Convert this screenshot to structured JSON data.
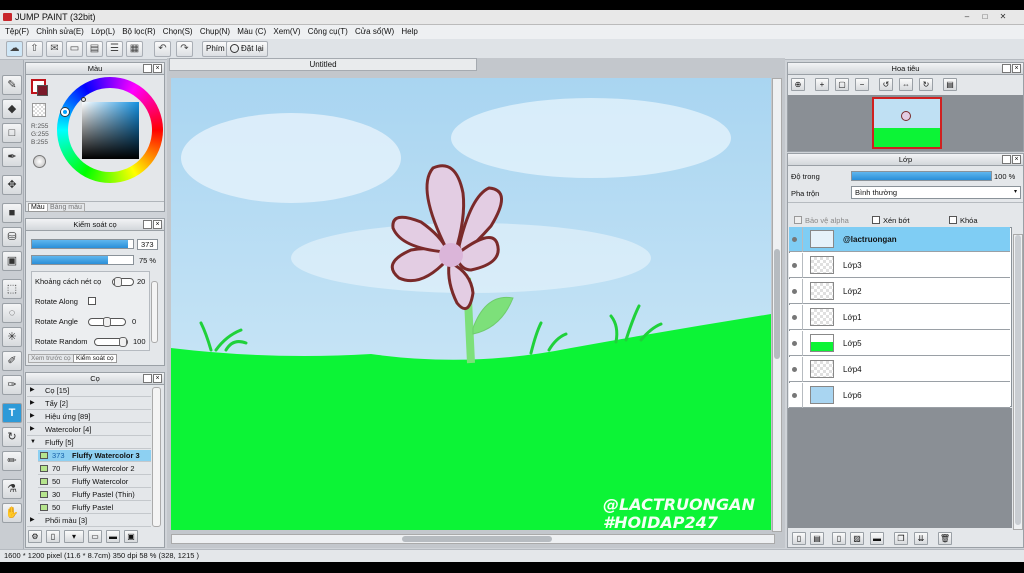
{
  "window": {
    "title": "JUMP PAINT (32bit)",
    "controls": [
      "–",
      "□",
      "✕"
    ]
  },
  "menu": [
    "Tệp(F)",
    "Chỉnh sửa(E)",
    "Lớp(L)",
    "Bộ lọc(R)",
    "Chọn(S)",
    "Chụp(N)",
    "Màu (C)",
    "Xem(V)",
    "Công cụ(T)",
    "Cửa sổ(W)",
    "Help"
  ],
  "toolbar": {
    "phim_label": "Phím",
    "reset_label": "Đặt lại"
  },
  "color_panel": {
    "title": "Màu",
    "rgb": [
      "R:255",
      "G:255",
      "B:255"
    ],
    "tabs": [
      "Màu",
      "Bảng màu"
    ]
  },
  "brush_control": {
    "title": "Kiểm soát cọ",
    "size": "373",
    "opacity": "75 %",
    "size_level": 0.95,
    "opacity_level": 0.75,
    "rows": [
      {
        "label": "Khoảng cách nét cọ",
        "value": "20"
      },
      {
        "label": "Rotate Along",
        "value": ""
      },
      {
        "label": "Rotate Angle",
        "value": "0"
      },
      {
        "label": "Rotate Random",
        "value": "100"
      }
    ],
    "tabs": [
      "Xem trước cọ",
      "Kiểm soát cọ"
    ]
  },
  "brush_panel": {
    "title": "Cọ",
    "groups": [
      {
        "arrow": "▶",
        "name": "Cọ [15]"
      },
      {
        "arrow": "▶",
        "name": "Tẩy [2]"
      },
      {
        "arrow": "▶",
        "name": "Hiệu ứng [89]"
      },
      {
        "arrow": "▶",
        "name": "Watercolor [4]"
      },
      {
        "arrow": "▼",
        "name": "Fluffy [5]"
      }
    ],
    "brushes": [
      {
        "size": "373",
        "name": "Fluffy Watercolor 3"
      },
      {
        "size": "70",
        "name": "Fluffy Watercolor 2"
      },
      {
        "size": "50",
        "name": "Fluffy Watercolor"
      },
      {
        "size": "30",
        "name": "Fluffy Pastel (Thin)"
      },
      {
        "size": "50",
        "name": "Fluffy Pastel"
      }
    ],
    "last_group": {
      "arrow": "▶",
      "name": "Phối màu [3]"
    }
  },
  "canvas": {
    "tab_title": "Untitled",
    "watermark_line1": "@LACTRUONGAN",
    "watermark_line2": "#HOIDAP247",
    "colors": {
      "sky": "#bfe0f3",
      "grass": "#0cf436",
      "petal": "#e3cde3",
      "outline": "#7a2a2a",
      "stem": "#7de07a"
    }
  },
  "navigator": {
    "title": "Hoa tiêu"
  },
  "layers_panel": {
    "title": "Lớp",
    "opacity_label": "Độ trong",
    "opacity_value": "100 %",
    "opacity_level": 1.0,
    "blend_label": "Pha trộn",
    "blend_value": "Bình thường",
    "checkboxes": [
      "Bảo vệ alpha",
      "Xén bớt",
      "Khóa"
    ],
    "layers": [
      {
        "name": "@lactruongan",
        "selected": true
      },
      {
        "name": "Lớp3",
        "selected": false
      },
      {
        "name": "Lớp2",
        "selected": false
      },
      {
        "name": "Lớp1",
        "selected": false
      },
      {
        "name": "Lớp5",
        "selected": false
      },
      {
        "name": "Lớp4",
        "selected": false
      },
      {
        "name": "Lớp6",
        "selected": false
      }
    ]
  },
  "status": {
    "text": "1600 * 1200 pixel  (11.6 * 8.7cm)  350 dpi  58 %  (328, 1215 )"
  }
}
